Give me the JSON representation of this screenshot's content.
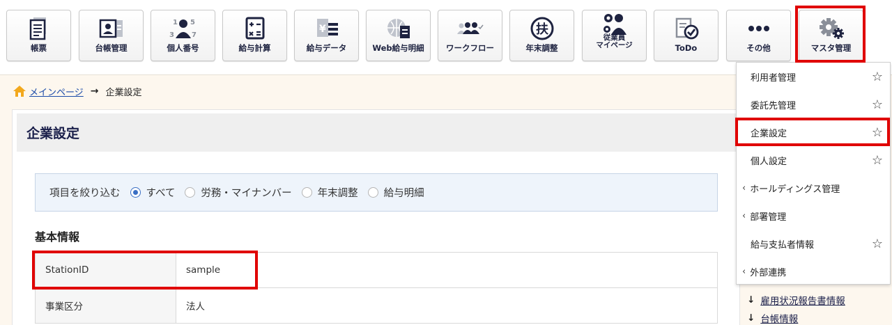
{
  "toolbar": {
    "buttons": [
      {
        "label": "帳票"
      },
      {
        "label": "台帳管理"
      },
      {
        "label": "個人番号"
      },
      {
        "label": "給与計算"
      },
      {
        "label": "給与データ"
      },
      {
        "label": "Web給与明細"
      },
      {
        "label": "ワークフロー"
      },
      {
        "label": "年末調整"
      },
      {
        "label_line1": "従業員",
        "label_line2": "マイページ"
      },
      {
        "label": "ToDo"
      },
      {
        "label": "その他"
      },
      {
        "label": "マスタ管理"
      }
    ],
    "number_icon_digits": [
      "1",
      "5",
      "3",
      "7"
    ],
    "yen_symbol": "¥",
    "nenmatsu_glyph": "扶"
  },
  "breadcrumb": {
    "home_label": "メインページ",
    "arrow": "→",
    "current": "企業設定"
  },
  "page": {
    "title": "企業設定"
  },
  "filter": {
    "label": "項目を絞り込む",
    "options": [
      {
        "label": "すべて",
        "selected": true
      },
      {
        "label": "労務・マイナンバー",
        "selected": false
      },
      {
        "label": "年末調整",
        "selected": false
      },
      {
        "label": "給与明細",
        "selected": false
      }
    ]
  },
  "basic_info": {
    "title": "基本情報",
    "rows": [
      {
        "key": "StationID",
        "value": "sample"
      },
      {
        "key": "事業区分",
        "value": "法人"
      }
    ]
  },
  "side_links": [
    {
      "arrow": "↓",
      "label": "雇用状況報告書情報"
    },
    {
      "arrow": "↓",
      "label": "台帳情報"
    }
  ],
  "dropdown": {
    "items": [
      {
        "label": "利用者管理",
        "star": "☆",
        "chevron": ""
      },
      {
        "label": "委託先管理",
        "star": "☆",
        "chevron": ""
      },
      {
        "label": "企業設定",
        "star": "☆",
        "chevron": ""
      },
      {
        "label": "個人設定",
        "star": "☆",
        "chevron": ""
      },
      {
        "label": "ホールディングス管理",
        "star": "",
        "chevron": "‹"
      },
      {
        "label": "部署管理",
        "star": "",
        "chevron": "‹"
      },
      {
        "label": "給与支払者情報",
        "star": "☆",
        "chevron": ""
      },
      {
        "label": "外部連携",
        "star": "",
        "chevron": "‹"
      }
    ]
  },
  "colors": {
    "icon_navy": "#1e2340",
    "icon_gray": "#8a8f99",
    "highlight_red": "#e00000",
    "band_bg": "#fdf7ee",
    "link_blue": "#1a4aa8"
  }
}
